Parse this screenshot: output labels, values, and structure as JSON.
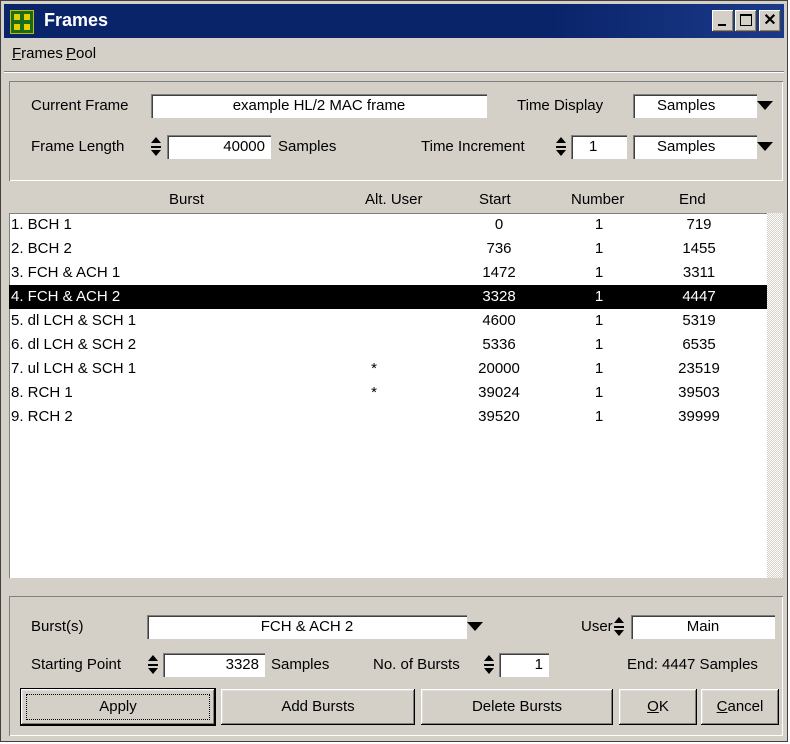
{
  "window": {
    "title": "Frames"
  },
  "menu": [
    {
      "accel": "F",
      "rest": "rames"
    },
    {
      "accel": "P",
      "rest": "ool"
    }
  ],
  "frame": {
    "current_frame_label": "Current Frame",
    "current_frame_value": "example HL/2 MAC frame",
    "time_display_label": "Time Display",
    "time_display_value": "Samples",
    "frame_length_label": "Frame Length",
    "frame_length_value": "40000",
    "frame_length_unit": "Samples",
    "time_increment_label": "Time Increment",
    "time_increment_value": "1",
    "time_increment_unit": "Samples"
  },
  "table": {
    "columns": [
      "Burst",
      "Alt. User",
      "Start",
      "Number",
      "End"
    ],
    "rows": [
      {
        "burst": "1. BCH 1",
        "alt": "",
        "start": "0",
        "number": "1",
        "end": "719"
      },
      {
        "burst": "2. BCH 2",
        "alt": "",
        "start": "736",
        "number": "1",
        "end": "1455"
      },
      {
        "burst": "3. FCH & ACH 1",
        "alt": "",
        "start": "1472",
        "number": "1",
        "end": "3311"
      },
      {
        "burst": "4. FCH & ACH 2",
        "alt": "",
        "start": "3328",
        "number": "1",
        "end": "4447"
      },
      {
        "burst": "5. dl LCH & SCH 1",
        "alt": "",
        "start": "4600",
        "number": "1",
        "end": "5319"
      },
      {
        "burst": "6. dl LCH & SCH 2",
        "alt": "",
        "start": "5336",
        "number": "1",
        "end": "6535"
      },
      {
        "burst": "7. ul LCH & SCH 1",
        "alt": "*",
        "start": "20000",
        "number": "1",
        "end": "23519"
      },
      {
        "burst": "8. RCH 1",
        "alt": "*",
        "start": "39024",
        "number": "1",
        "end": "39503"
      },
      {
        "burst": "9. RCH 2",
        "alt": "",
        "start": "39520",
        "number": "1",
        "end": "39999"
      }
    ],
    "selected_index": 3
  },
  "burst": {
    "bursts_label": "Burst(s)",
    "bursts_value": "FCH & ACH 2",
    "user_label": "User",
    "user_value": "Main",
    "starting_point_label": "Starting Point",
    "starting_point_value": "3328",
    "starting_point_unit": "Samples",
    "num_bursts_label": "No. of Bursts",
    "num_bursts_value": "1",
    "end_text": "End: 4447 Samples"
  },
  "buttons": {
    "apply": "Apply",
    "add_bursts": "Add Bursts",
    "delete_bursts": "Delete Bursts",
    "ok_accel": "O",
    "ok_rest": "K",
    "cancel_accel": "C",
    "cancel_rest": "ancel"
  }
}
